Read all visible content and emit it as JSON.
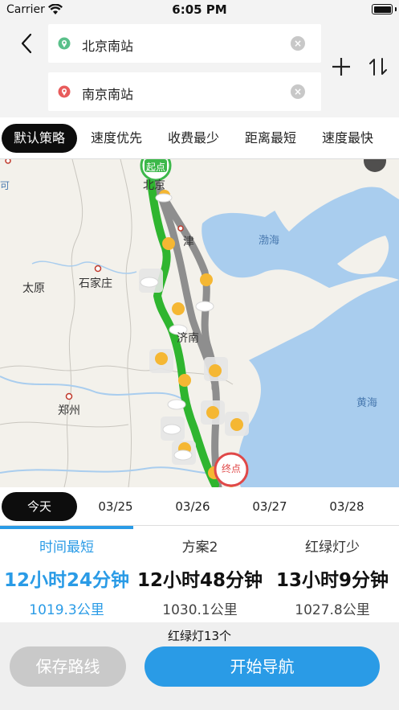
{
  "status_bar": {
    "carrier": "Carrier",
    "time": "6:05 PM"
  },
  "route": {
    "start_text": "北京南站",
    "end_text": "南京南站",
    "start_color": "#5ac08a",
    "end_color": "#e85b5b"
  },
  "strategies": [
    {
      "label": "默认策略",
      "active": true
    },
    {
      "label": "速度优先",
      "active": false
    },
    {
      "label": "收费最少",
      "active": false
    },
    {
      "label": "距离最短",
      "active": false
    },
    {
      "label": "速度最快",
      "active": false
    }
  ],
  "map": {
    "start_marker": "起点",
    "end_marker": "终点",
    "cities": {
      "beijing": "北京",
      "tianjin": "津",
      "taiyuan": "太原",
      "shijiazhuang": "石家庄",
      "jinan": "济南",
      "zhengzhou": "郑州",
      "edge": "可"
    },
    "seas": {
      "bohai": "渤海",
      "huanghai": "黄海"
    },
    "route_color": "#2fb52f",
    "alt_route_color": "#8e8e8e"
  },
  "dates": [
    {
      "label": "今天",
      "active": true
    },
    {
      "label": "03/25",
      "active": false
    },
    {
      "label": "03/26",
      "active": false
    },
    {
      "label": "03/27",
      "active": false
    },
    {
      "label": "03/28",
      "active": false
    }
  ],
  "plans": [
    {
      "name": "时间最短",
      "time": "12小时24分钟",
      "distance": "1019.3公里",
      "selected": true
    },
    {
      "name": "方案2",
      "time": "12小时48分钟",
      "distance": "1030.1公里",
      "selected": false
    },
    {
      "name": "红绿灯少",
      "time": "13小时9分钟",
      "distance": "1027.8公里",
      "selected": false
    }
  ],
  "bottom": {
    "traffic_lights": "红绿灯13个",
    "save_label": "保存路线",
    "navigate_label": "开始导航"
  },
  "colors": {
    "accent": "#2a9be6",
    "dark": "#0d0d0d"
  }
}
